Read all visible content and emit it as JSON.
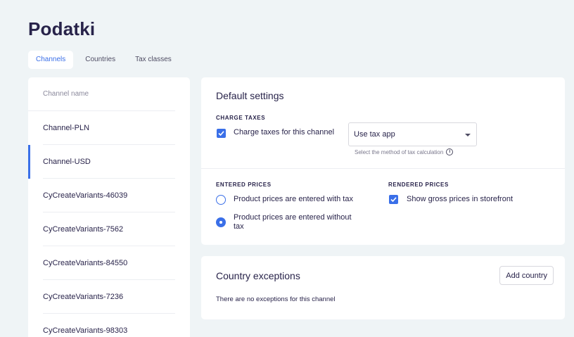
{
  "page": {
    "title": "Podatki"
  },
  "tabs": [
    {
      "label": "Channels",
      "active": true
    },
    {
      "label": "Countries",
      "active": false
    },
    {
      "label": "Tax classes",
      "active": false
    }
  ],
  "channels": {
    "header": "Channel name",
    "items": [
      "Channel-PLN",
      "Channel-USD",
      "CyCreateVariants-46039",
      "CyCreateVariants-7562",
      "CyCreateVariants-84550",
      "CyCreateVariants-7236",
      "CyCreateVariants-98303"
    ],
    "selected": "Channel-USD"
  },
  "default_settings": {
    "title": "Default settings",
    "charge_taxes": {
      "section_label": "CHARGE TAXES",
      "checkbox_label": "Charge taxes for this channel",
      "checked": true,
      "select_value": "Use tax app",
      "helper_text": "Select the method of tax calculation"
    },
    "entered_prices": {
      "section_label": "ENTERED PRICES",
      "option_with_tax": "Product prices are entered with tax",
      "option_without_tax_line1": "Product prices are entered without",
      "option_without_tax_line2": "tax",
      "selected": "without_tax"
    },
    "rendered_prices": {
      "section_label": "RENDERED PRICES",
      "checkbox_label": "Show gross prices in storefront",
      "checked": true
    }
  },
  "country_exceptions": {
    "title": "Country exceptions",
    "add_button": "Add country",
    "empty_text": "There are no exceptions for this channel"
  },
  "colors": {
    "accent": "#3a6fe8",
    "background": "#eff4f6",
    "text": "#28234a"
  }
}
